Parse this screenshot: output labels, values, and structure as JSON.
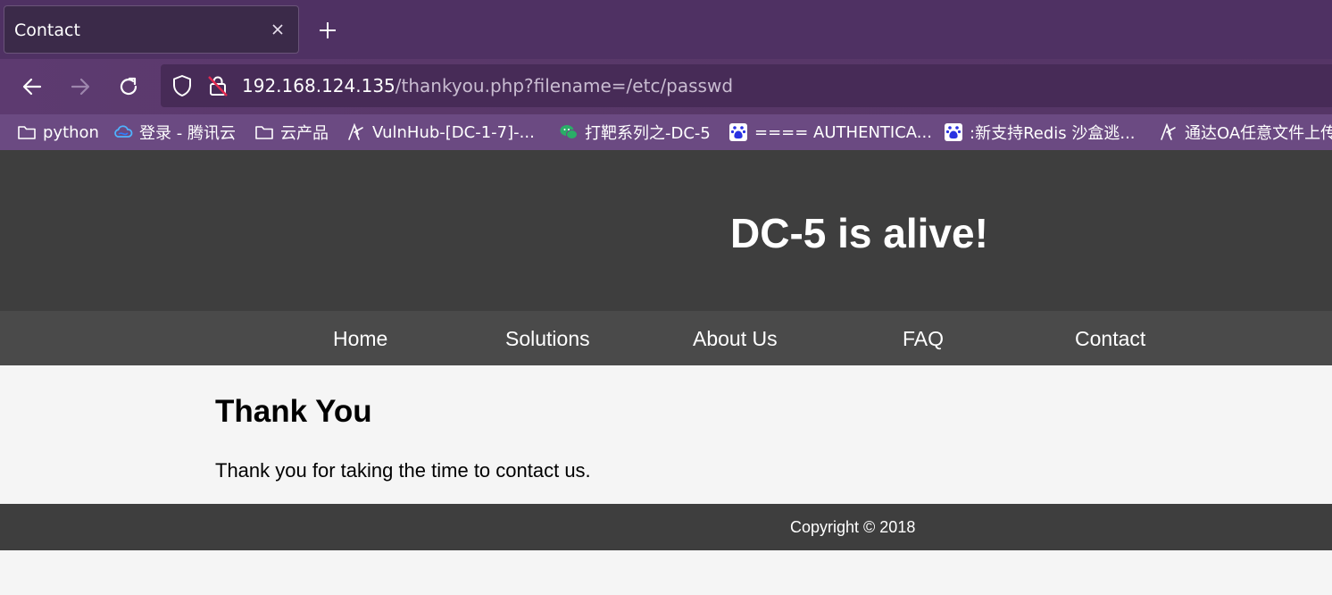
{
  "browser": {
    "tab": {
      "title": "Contact",
      "close_icon": "close-icon"
    },
    "new_tab_icon": "plus-icon",
    "nav": {
      "back_icon": "back-arrow-icon",
      "forward_icon": "forward-arrow-icon",
      "reload_icon": "reload-icon"
    },
    "url": {
      "host": "192.168.124.135",
      "path": "/thankyou.php?filename=/etc/passwd",
      "shield_icon": "shield-icon",
      "insecure_icon": "insecure-lock-icon"
    },
    "bookmarks": [
      {
        "label": "python",
        "icon": "folder-icon"
      },
      {
        "label": "登录 - 腾讯云",
        "icon": "cloud-icon"
      },
      {
        "label": "云产品",
        "icon": "folder-icon"
      },
      {
        "label": "VulnHub-[DC-1-7]-...",
        "icon": "site-logo-icon"
      },
      {
        "label": "打靶系列之-DC-5",
        "icon": "wechat-icon"
      },
      {
        "label": "==== AUTHENTICA...",
        "icon": "baidu-icon"
      },
      {
        "label": ":新支持Redis 沙盒逃...",
        "icon": "baidu-icon"
      },
      {
        "label": "通达OA任意文件上传",
        "icon": "site-logo-icon"
      }
    ],
    "colors": {
      "tabbar": "#4f3163",
      "toolbar": "#5d3a70",
      "bookmarks": "#6b4a82"
    }
  },
  "site": {
    "title": "DC-5 is alive!",
    "nav": [
      "Home",
      "Solutions",
      "About Us",
      "FAQ",
      "Contact"
    ],
    "heading": "Thank You",
    "message": "Thank you for taking the time to contact us.",
    "footer": "Copyright © 2018",
    "colors": {
      "header": "#3e3e3e",
      "nav": "#4a4a4a",
      "body": "#f5f5f5"
    }
  }
}
